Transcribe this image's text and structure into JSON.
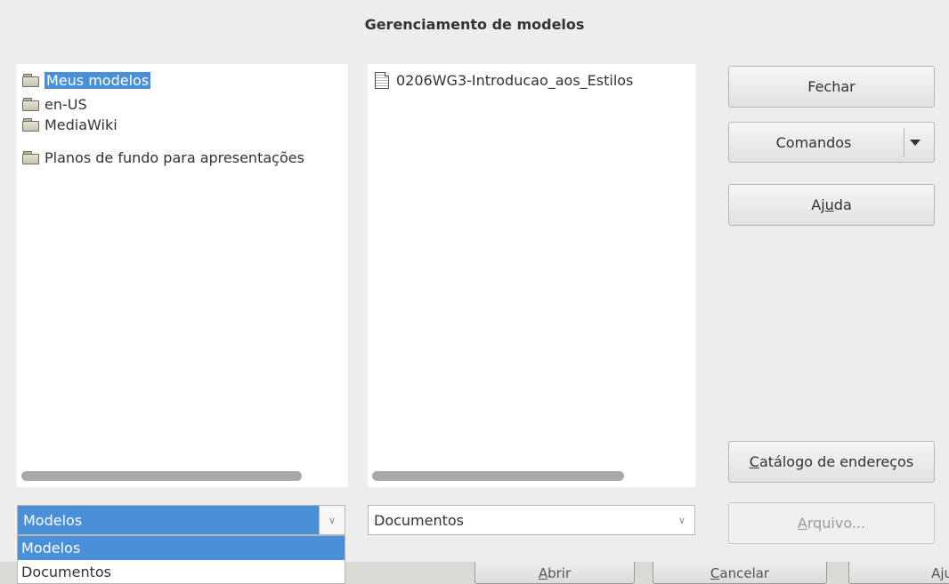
{
  "dialog": {
    "title": "Gerenciamento de modelos"
  },
  "left_tree": {
    "items": [
      {
        "label": "Meus modelos",
        "selected": true,
        "icon": "folder-icon"
      },
      {
        "label": "en-US",
        "selected": false,
        "icon": "folder-icon"
      },
      {
        "label": "MediaWiki",
        "selected": false,
        "icon": "folder-icon"
      },
      {
        "label": "Planos de fundo para apresentações",
        "selected": false,
        "icon": "folder-icon"
      }
    ]
  },
  "middle_list": {
    "items": [
      {
        "label": "0206WG3-Introducao_aos_Estilos",
        "icon": "document-icon"
      }
    ]
  },
  "buttons": {
    "close": "Fechar",
    "commands": "Comandos",
    "help_pre": "Aj",
    "help_u": "u",
    "help_post": "da",
    "address_u": "C",
    "address_rest": "atálogo de endereços",
    "file_u": "A",
    "file_rest": "rquivo..."
  },
  "combos": {
    "left_value": "Modelos",
    "right_value": "Documentos"
  },
  "dropdown": {
    "options": [
      "Modelos",
      "Documentos"
    ],
    "selected": "Modelos"
  },
  "underlying": {
    "open_u": "A",
    "open_rest": "brir",
    "cancel_u": "C",
    "cancel_rest": "ancelar",
    "help": "Aju"
  },
  "colors": {
    "selection": "#4a90d9",
    "dialog_bg": "#ededed"
  }
}
